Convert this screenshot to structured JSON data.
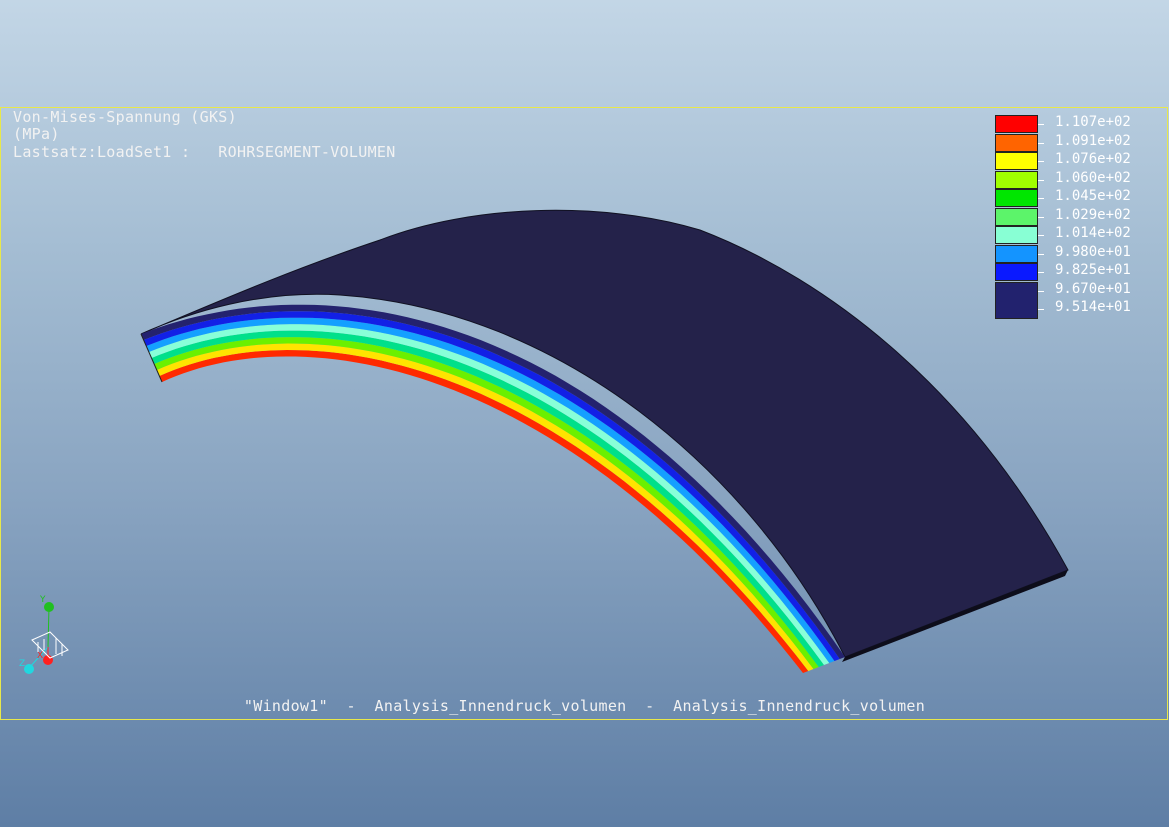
{
  "header": {
    "title": "Von-Mises-Spannung (GKS)",
    "unit": "(MPa)",
    "loadset": "Lastsatz:LoadSet1 :   ROHRSEGMENT-VOLUMEN"
  },
  "footer": {
    "caption": "\"Window1\"  -  Analysis_Innendruck_volumen  -  Analysis_Innendruck_volumen"
  },
  "legend": {
    "entries": [
      {
        "value": "1.107e+02",
        "color": "#ff0000"
      },
      {
        "value": "1.091e+02",
        "color": "#ff6400"
      },
      {
        "value": "1.076e+02",
        "color": "#ffff00"
      },
      {
        "value": "1.060e+02",
        "color": "#a0ff00"
      },
      {
        "value": "1.045e+02",
        "color": "#00e600"
      },
      {
        "value": "1.029e+02",
        "color": "#5cf46a"
      },
      {
        "value": "1.014e+02",
        "color": "#88ffd4"
      },
      {
        "value": "9.980e+01",
        "color": "#1494ff"
      },
      {
        "value": "9.825e+01",
        "color": "#0a19ff"
      },
      {
        "value": "9.670e+01",
        "color": "#22226e"
      },
      {
        "value": "9.514e+01",
        "color": "#22226e"
      }
    ]
  },
  "model": {
    "outer_surface_color": "#24224a",
    "band_colors": [
      "#ff2a00",
      "#ffe400",
      "#6bf000",
      "#00e08a",
      "#88ffd8",
      "#14a0ff",
      "#1220e6",
      "#24226e"
    ]
  },
  "triad": {
    "x_label": "X",
    "y_label": "Y",
    "z_label": "Z",
    "x_color": "#ff2020",
    "y_color": "#20c020",
    "z_color": "#20d8e0"
  }
}
